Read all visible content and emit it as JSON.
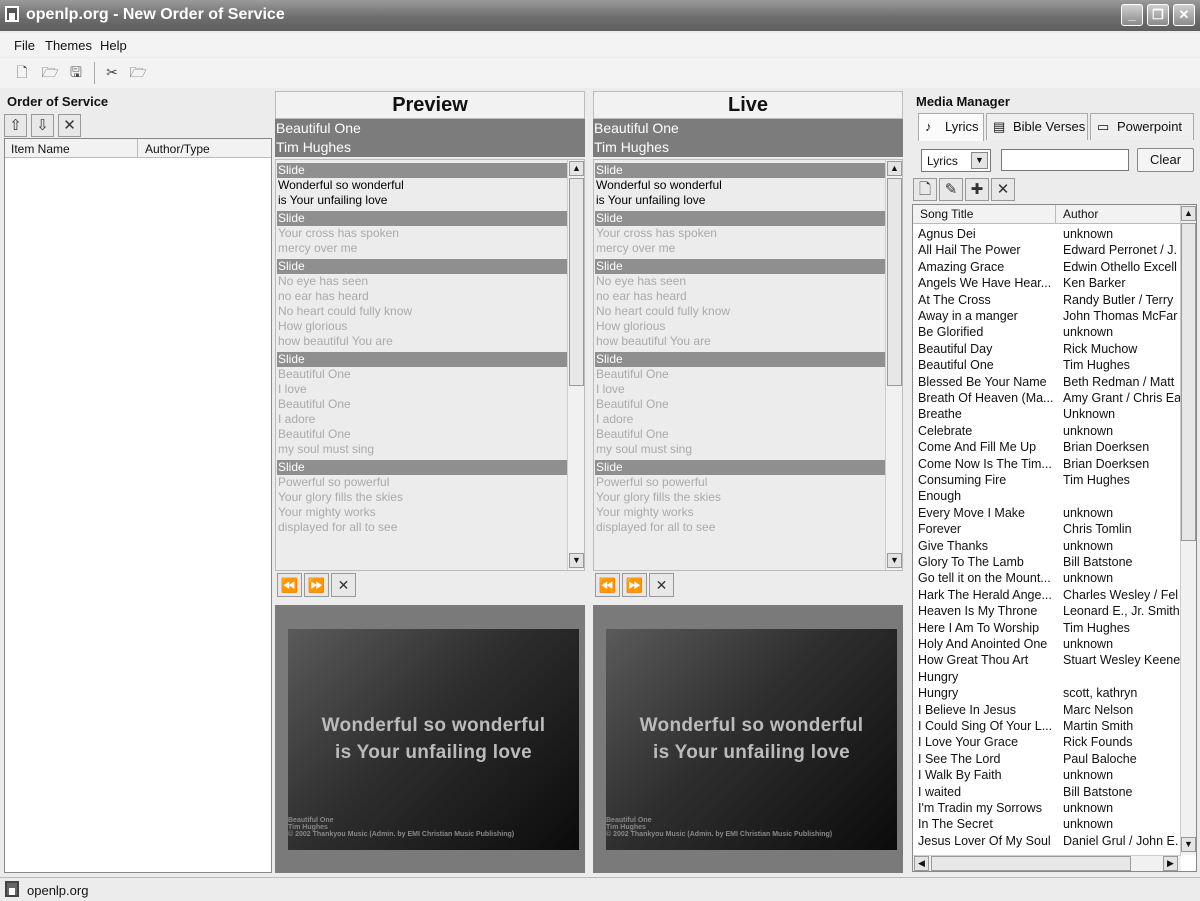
{
  "window": {
    "title": "openlp.org - New Order of Service",
    "min": "_",
    "max": "❐",
    "close": "✕"
  },
  "menu": [
    "File",
    "Themes",
    "Help"
  ],
  "order_panel": {
    "title": "Order of Service",
    "columns": [
      "Item Name",
      "Author/Type"
    ]
  },
  "preview": {
    "title": "Preview",
    "song_title": "Beautiful One",
    "song_author": "Tim Hughes"
  },
  "live": {
    "title": "Live",
    "song_title": "Beautiful One",
    "song_author": "Tim Hughes"
  },
  "slide_label": "Slide",
  "slides": [
    [
      "Wonderful so wonderful",
      "is Your unfailing love"
    ],
    [
      "Your cross has spoken",
      "mercy over me"
    ],
    [
      "No eye has seen",
      "no ear has heard",
      "No heart could fully know",
      "How glorious",
      "how beautiful You are"
    ],
    [
      "Beautiful One",
      "I love",
      "Beautiful One",
      "I adore",
      "Beautiful One",
      " my soul must sing"
    ],
    [
      "Powerful so powerful",
      "Your glory fills the skies",
      "Your mighty works",
      "displayed for all to see"
    ]
  ],
  "display": {
    "line1": "Wonderful so wonderful",
    "line2": "is Your unfailing love",
    "footer1": "Beautiful One",
    "footer2": "Tim Hughes",
    "footer3": "© 2002 Thankyou Music (Admin. by EMI Christian Music Publishing)"
  },
  "media_manager": {
    "title": "Media Manager",
    "tabs": [
      "Lyrics",
      "Bible Verses",
      "Powerpoint"
    ],
    "type_select": "Lyrics",
    "search_value": "",
    "clear_label": "Clear",
    "columns": [
      "Song Title",
      "Author"
    ],
    "songs": [
      [
        "Agnus Dei",
        "unknown"
      ],
      [
        "All Hail The Power",
        "Edward Perronet / J."
      ],
      [
        "Amazing Grace",
        "Edwin Othello Excell"
      ],
      [
        "Angels We Have Hear...",
        "Ken Barker"
      ],
      [
        "At The Cross",
        "Randy Butler / Terry"
      ],
      [
        "Away in a manger",
        "John Thomas McFar"
      ],
      [
        "Be Glorified",
        "unknown"
      ],
      [
        "Beautiful Day",
        "Rick Muchow"
      ],
      [
        "Beautiful One",
        "Tim Hughes"
      ],
      [
        "Blessed Be Your Name",
        "Beth Redman / Matt"
      ],
      [
        "Breath Of Heaven (Ma...",
        "Amy Grant / Chris Ea"
      ],
      [
        "Breathe",
        "Unknown"
      ],
      [
        "Celebrate",
        "unknown"
      ],
      [
        "Come And Fill Me Up",
        "Brian Doerksen"
      ],
      [
        "Come Now Is The Tim...",
        "Brian Doerksen"
      ],
      [
        "Consuming Fire",
        "Tim Hughes"
      ],
      [
        "Enough",
        ""
      ],
      [
        "Every Move I Make",
        "unknown"
      ],
      [
        "Forever",
        "Chris Tomlin"
      ],
      [
        "Give Thanks",
        "unknown"
      ],
      [
        "Glory To The Lamb",
        "Bill Batstone"
      ],
      [
        "Go tell it on the Mount...",
        "unknown"
      ],
      [
        "Hark The Herald Ange...",
        "Charles Wesley / Fel"
      ],
      [
        "Heaven Is My Throne",
        "Leonard E., Jr. Smith"
      ],
      [
        "Here I Am To Worship",
        "Tim Hughes"
      ],
      [
        "Holy And Anointed One",
        "unknown"
      ],
      [
        "How Great Thou Art",
        "Stuart Wesley Keene"
      ],
      [
        "Hungry",
        ""
      ],
      [
        "Hungry",
        "scott, kathryn"
      ],
      [
        "I Believe In Jesus",
        "Marc Nelson"
      ],
      [
        "I Could Sing Of Your L...",
        "Martin Smith"
      ],
      [
        "I Love Your Grace",
        "Rick Founds"
      ],
      [
        "I See The Lord",
        "Paul Baloche"
      ],
      [
        "I Walk By Faith",
        "unknown"
      ],
      [
        "I waited",
        "Bill Batstone"
      ],
      [
        "I'm Tradin my Sorrows",
        "unknown"
      ],
      [
        "In The Secret",
        "unknown"
      ],
      [
        "Jesus Lover Of My Soul",
        "Daniel Grul / John E."
      ]
    ]
  },
  "status": "openlp.org"
}
